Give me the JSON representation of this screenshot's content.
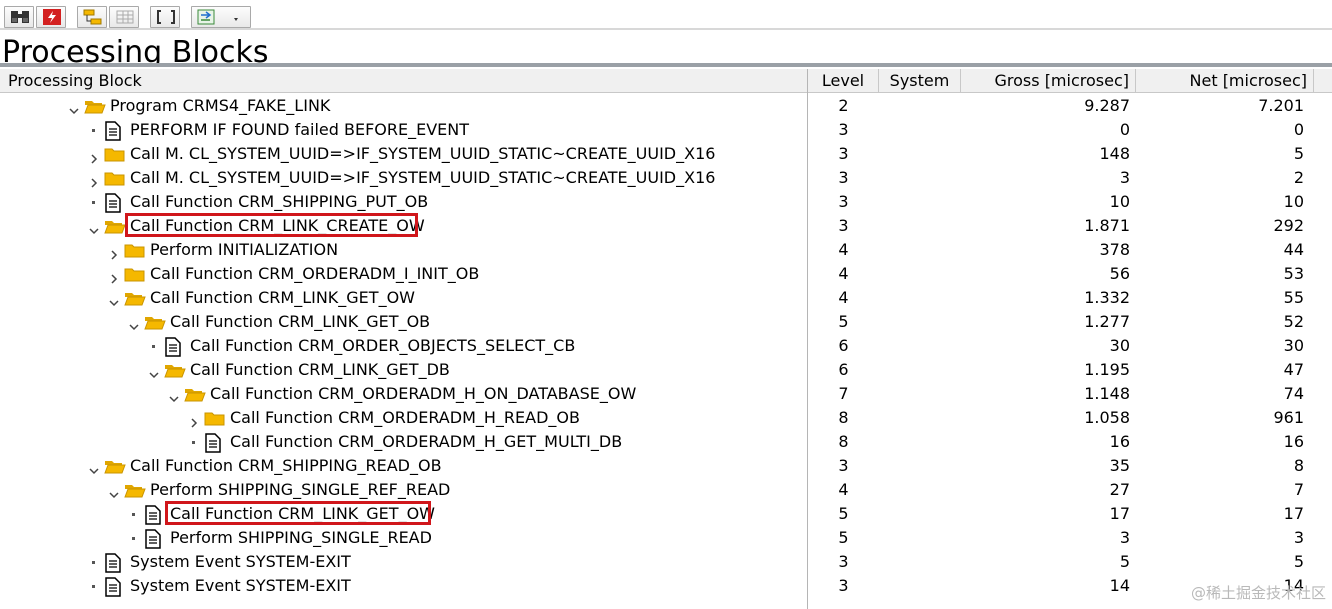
{
  "page_title": "Processing Blocks",
  "toolbar": {
    "buttons": [
      {
        "icon": "binoculars-icon"
      },
      {
        "icon": "delete-flash-icon"
      },
      {
        "icon": "hierarchy-icon"
      },
      {
        "icon": "grid-disabled-icon"
      },
      {
        "icon": "brackets-icon"
      },
      {
        "icon": "export-dropdown-icon"
      }
    ]
  },
  "columns": {
    "block": "Processing Block",
    "level": "Level",
    "system": "System",
    "gross": "Gross [microsec]",
    "net": "Net [microsec]"
  },
  "rows": [
    {
      "depth": 0,
      "expander": "open",
      "icon": "folder-open",
      "label": "Program CRMS4_FAKE_LINK",
      "level": "2",
      "system": "",
      "gross": "9.287",
      "net": "7.201"
    },
    {
      "depth": 1,
      "expander": "leaf",
      "icon": "document",
      "label": "PERFORM IF FOUND failed BEFORE_EVENT",
      "level": "3",
      "system": "",
      "gross": "0",
      "net": "0"
    },
    {
      "depth": 1,
      "expander": "closed",
      "icon": "folder",
      "label": "Call M. CL_SYSTEM_UUID=>IF_SYSTEM_UUID_STATIC~CREATE_UUID_X16",
      "level": "3",
      "system": "",
      "gross": "148",
      "net": "5"
    },
    {
      "depth": 1,
      "expander": "closed",
      "icon": "folder",
      "label": "Call M. CL_SYSTEM_UUID=>IF_SYSTEM_UUID_STATIC~CREATE_UUID_X16",
      "level": "3",
      "system": "",
      "gross": "3",
      "net": "2"
    },
    {
      "depth": 1,
      "expander": "leaf",
      "icon": "document",
      "label": "Call Function CRM_SHIPPING_PUT_OB",
      "level": "3",
      "system": "",
      "gross": "10",
      "net": "10"
    },
    {
      "depth": 1,
      "expander": "open",
      "icon": "folder-open",
      "label": "Call Function CRM_LINK_CREATE_OW",
      "level": "3",
      "system": "",
      "gross": "1.871",
      "net": "292",
      "highlight": true
    },
    {
      "depth": 2,
      "expander": "closed",
      "icon": "folder",
      "label": "Perform INITIALIZATION",
      "level": "4",
      "system": "",
      "gross": "378",
      "net": "44"
    },
    {
      "depth": 2,
      "expander": "closed",
      "icon": "folder",
      "label": "Call Function CRM_ORDERADM_I_INIT_OB",
      "level": "4",
      "system": "",
      "gross": "56",
      "net": "53"
    },
    {
      "depth": 2,
      "expander": "open",
      "icon": "folder-open",
      "label": "Call Function CRM_LINK_GET_OW",
      "level": "4",
      "system": "",
      "gross": "1.332",
      "net": "55"
    },
    {
      "depth": 3,
      "expander": "open",
      "icon": "folder-open",
      "label": "Call Function CRM_LINK_GET_OB",
      "level": "5",
      "system": "",
      "gross": "1.277",
      "net": "52"
    },
    {
      "depth": 4,
      "expander": "leaf",
      "icon": "document",
      "label": "Call Function CRM_ORDER_OBJECTS_SELECT_CB",
      "level": "6",
      "system": "",
      "gross": "30",
      "net": "30"
    },
    {
      "depth": 4,
      "expander": "open",
      "icon": "folder-open",
      "label": "Call Function CRM_LINK_GET_DB",
      "level": "6",
      "system": "",
      "gross": "1.195",
      "net": "47"
    },
    {
      "depth": 5,
      "expander": "open",
      "icon": "folder-open",
      "label": "Call Function CRM_ORDERADM_H_ON_DATABASE_OW",
      "level": "7",
      "system": "",
      "gross": "1.148",
      "net": "74"
    },
    {
      "depth": 6,
      "expander": "closed",
      "icon": "folder",
      "label": "Call Function CRM_ORDERADM_H_READ_OB",
      "level": "8",
      "system": "",
      "gross": "1.058",
      "net": "961"
    },
    {
      "depth": 6,
      "expander": "leaf",
      "icon": "document",
      "label": "Call Function CRM_ORDERADM_H_GET_MULTI_DB",
      "level": "8",
      "system": "",
      "gross": "16",
      "net": "16"
    },
    {
      "depth": 1,
      "expander": "open",
      "icon": "folder-open",
      "label": "Call Function CRM_SHIPPING_READ_OB",
      "level": "3",
      "system": "",
      "gross": "35",
      "net": "8"
    },
    {
      "depth": 2,
      "expander": "open",
      "icon": "folder-open",
      "label": "Perform SHIPPING_SINGLE_REF_READ",
      "level": "4",
      "system": "",
      "gross": "27",
      "net": "7"
    },
    {
      "depth": 3,
      "expander": "leaf",
      "icon": "document",
      "label": "Call Function CRM_LINK_GET_OW",
      "level": "5",
      "system": "",
      "gross": "17",
      "net": "17",
      "highlight": true
    },
    {
      "depth": 3,
      "expander": "leaf",
      "icon": "document",
      "label": "Perform SHIPPING_SINGLE_READ",
      "level": "5",
      "system": "",
      "gross": "3",
      "net": "3"
    },
    {
      "depth": 1,
      "expander": "leaf",
      "icon": "document",
      "label": "System Event SYSTEM-EXIT",
      "level": "3",
      "system": "",
      "gross": "5",
      "net": "5"
    },
    {
      "depth": 1,
      "expander": "leaf",
      "icon": "document",
      "label": "System Event SYSTEM-EXIT",
      "level": "3",
      "system": "",
      "gross": "14",
      "net": "14"
    }
  ],
  "watermark": "@稀土掘金技术社区",
  "colors": {
    "highlight_border": "#d0161b",
    "folder": "#f5b800",
    "header_bg": "#f0f0f0"
  }
}
